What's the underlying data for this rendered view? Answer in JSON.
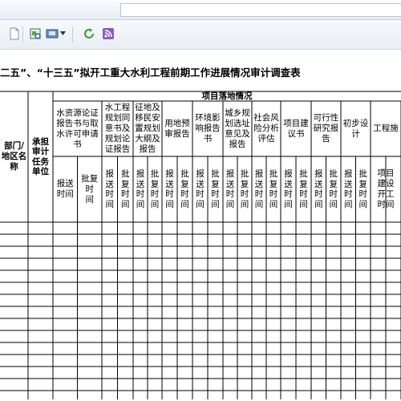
{
  "window": {
    "address": ""
  },
  "toolbar": {
    "icons": [
      "page-icon",
      "print-preview-icon",
      "save-icon",
      "dropdown-arrow-icon",
      "refresh-icon",
      "feed-icon"
    ]
  },
  "document": {
    "title": "二五”、“十三五”拟开工重大水利工程前期工作进展情况审计调查表",
    "headers": {
      "dept": "部门/\n地区名\n称",
      "unit": "承担\n审计\n任务\n单位",
      "group": "项目落地情况",
      "cols": [
        "水资源论证\n报告书与取\n水许可申请\n书",
        "水工程\n规划同\n意书及\n规划论\n证报告",
        "征地及\n移民安\n置规划\n大纲及\n报告",
        "用地预\n审报告",
        "环境影\n响报告\n书",
        "城乡规\n划选址\n意见及\n报告",
        "社会风\n险分析\n评估",
        "项目建\n议书",
        "可行性\n研究报\n告",
        "初步设\n计",
        "工程施"
      ],
      "sub_wide": [
        "报送\n时间",
        "批复时\n间"
      ],
      "sub_narrow": [
        "报\n送\n时\n间",
        "批\n复\n时\n间"
      ],
      "last_sub": "项目\n建设\n开工\n时间"
    }
  }
}
